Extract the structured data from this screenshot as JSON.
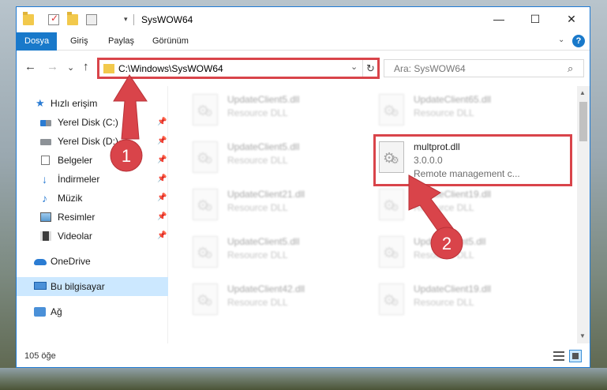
{
  "window": {
    "title": "SysWOW64",
    "controls": {
      "minimize": "—",
      "maximize": "☐",
      "close": "✕"
    }
  },
  "ribbon": {
    "tabs": [
      "Dosya",
      "Giriş",
      "Paylaş",
      "Görünüm"
    ],
    "help": "?",
    "expand": "⌄"
  },
  "nav": {
    "back": "←",
    "forward": "→",
    "recent": "⌄",
    "up": "↑",
    "address": "C:\\Windows\\SysWOW64",
    "address_dropdown": "⌄",
    "refresh": "↻",
    "search_placeholder": "Ara: SysWOW64",
    "search_glyph": "⌕"
  },
  "sidebar": {
    "items": [
      {
        "label": "Hızlı erişim",
        "icon": "star-icon",
        "pinned": false
      },
      {
        "label": "Yerel Disk (C:)",
        "icon": "drive-icon",
        "pinned": true
      },
      {
        "label": "Yerel Disk (D:)",
        "icon": "drive-icon",
        "pinned": true
      },
      {
        "label": "Belgeler",
        "icon": "documents-icon",
        "pinned": true
      },
      {
        "label": "İndirmeler",
        "icon": "downloads-icon",
        "pinned": true
      },
      {
        "label": "Müzik",
        "icon": "music-icon",
        "pinned": true
      },
      {
        "label": "Resimler",
        "icon": "pictures-icon",
        "pinned": true
      },
      {
        "label": "Videolar",
        "icon": "videos-icon",
        "pinned": true
      },
      {
        "label": "OneDrive",
        "icon": "onedrive-icon",
        "pinned": false
      },
      {
        "label": "Bu bilgisayar",
        "icon": "this-pc-icon",
        "pinned": false,
        "selected": true
      },
      {
        "label": "Ağ",
        "icon": "network-icon",
        "pinned": false
      }
    ],
    "pin_glyph": "📌"
  },
  "files": [
    {
      "name": "UpdateClient5.dll",
      "sub": "Resource DLL",
      "faded": true
    },
    {
      "name": "UpdateClient65.dll",
      "sub": "Resource DLL",
      "faded": true
    },
    {
      "name": "UpdateClient5.dll",
      "sub": "Resource DLL",
      "faded": true
    },
    {
      "name": "multprot.dll",
      "sub": "3.0.0.0",
      "sub2": "Remote management c...",
      "faded": false
    },
    {
      "name": "UpdateClient21.dll",
      "sub": "Resource DLL",
      "faded": true
    },
    {
      "name": "UpdateClient19.dll",
      "sub": "Resource DLL",
      "faded": true
    },
    {
      "name": "UpdateClient5.dll",
      "sub": "Resource DLL",
      "faded": true
    },
    {
      "name": "UpdateClient5.dll",
      "sub": "Resource DLL",
      "faded": true
    },
    {
      "name": "UpdateClient42.dll",
      "sub": "Resource DLL",
      "faded": true
    },
    {
      "name": "UpdateClient19.dll",
      "sub": "Resource DLL",
      "faded": true
    }
  ],
  "status": {
    "count": "105 öğe"
  },
  "callouts": {
    "step1": "1",
    "step2": "2",
    "color": "#d9444a"
  }
}
